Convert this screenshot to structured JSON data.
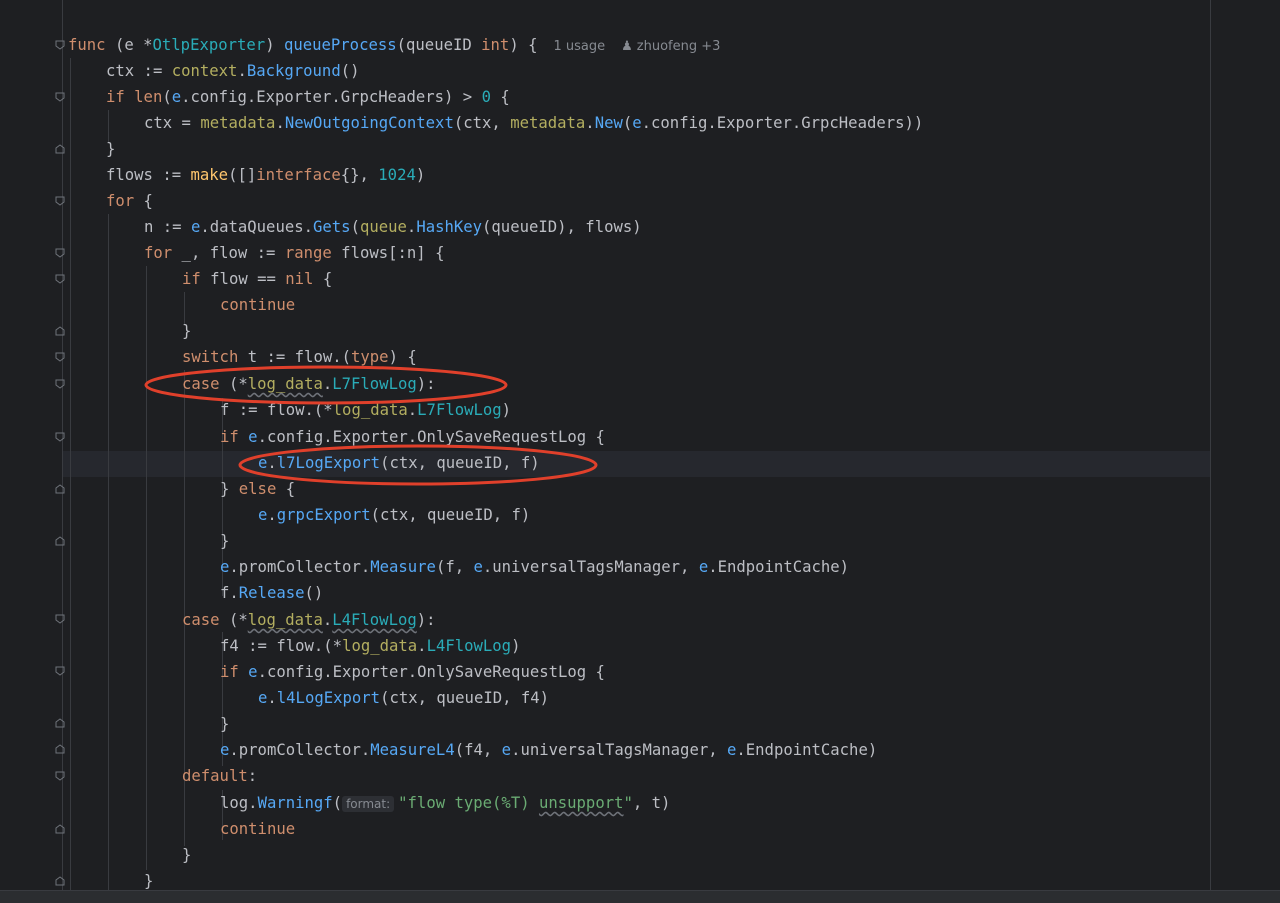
{
  "editor": {
    "hints": {
      "usages": "1 usage",
      "author": "zhuofeng +3",
      "format_param": "format:"
    },
    "code": {
      "l1_func": "func",
      "l1_recv_open": " (e *",
      "l1_type": "OtlpExporter",
      "l1_recv_close": ") ",
      "l1_name": "queueProcess",
      "l1_params_a": "(queueID ",
      "l1_int": "int",
      "l1_params_b": ") {",
      "l2_a": "ctx := ",
      "l2_pkg": "context",
      "l2_dot": ".",
      "l2_call": "Background",
      "l2_b": "()",
      "l3_if": "if ",
      "l3_len": "len",
      "l3_a": "(",
      "l3_e": "e",
      "l3_b": ".config.Exporter.GrpcHeaders) > ",
      "l3_zero": "0",
      "l3_c": " {",
      "l4_a": "ctx = ",
      "l4_pkg1": "metadata",
      "l4_dot1": ".",
      "l4_call1": "NewOutgoingContext",
      "l4_b": "(ctx, ",
      "l4_pkg2": "metadata",
      "l4_dot2": ".",
      "l4_call2": "New",
      "l4_c": "(",
      "l4_e": "e",
      "l4_d": ".config.Exporter.GrpcHeaders))",
      "l5": "}",
      "l6_a": "flows := ",
      "l6_make": "make",
      "l6_b": "([]",
      "l6_iface": "interface",
      "l6_c": "{}, ",
      "l6_num": "1024",
      "l6_d": ")",
      "l7_for": "for",
      "l7_a": " {",
      "l8_a": "n := ",
      "l8_e": "e",
      "l8_b": ".dataQueues.",
      "l8_call": "Gets",
      "l8_c": "(",
      "l8_pkg": "queue",
      "l8_dot": ".",
      "l8_call2": "HashKey",
      "l8_d": "(queueID), flows)",
      "l9_for": "for",
      "l9_a": " _, flow := ",
      "l9_range": "range",
      "l9_b": " flows[:n] {",
      "l10_if": "if",
      "l10_a": " flow == ",
      "l10_nil": "nil",
      "l10_b": " {",
      "l11_continue": "continue",
      "l12": "}",
      "l13_switch": "switch",
      "l13_a": " t := flow.(",
      "l13_type": "type",
      "l13_b": ") {",
      "l14_case": "case",
      "l14_a": " (*",
      "l14_pkg": "log_data",
      "l14_dot": ".",
      "l14_type": "L7FlowLog",
      "l14_b": "):",
      "l15_a": "f := flow.(*",
      "l15_pkg": "log_data",
      "l15_dot": ".",
      "l15_type": "L7FlowLog",
      "l15_b": ")",
      "l16_if": "if",
      "l16_a": " ",
      "l16_e": "e",
      "l16_b": ".config.Exporter.",
      "l16_field": "OnlySaveRequestLog",
      "l16_c": " {",
      "l17_e": "e",
      "l17_dot": ".",
      "l17_call": "l7LogExport",
      "l17_a": "(ctx, queueID, f)",
      "l18_a": "} ",
      "l18_else": "else",
      "l18_b": " {",
      "l19_e": "e",
      "l19_dot": ".",
      "l19_call": "grpcExport",
      "l19_a": "(ctx, queueID, f)",
      "l20": "}",
      "l21_e": "e",
      "l21_a": ".promCollector.",
      "l21_call": "Measure",
      "l21_b": "(f, ",
      "l21_e2": "e",
      "l21_c": ".universalTagsManager, ",
      "l21_e3": "e",
      "l21_d": ".EndpointCache)",
      "l22_a": "f.",
      "l22_call": "Release",
      "l22_b": "()",
      "l23_case": "case",
      "l23_a": " (*",
      "l23_pkg": "log_data",
      "l23_dot": ".",
      "l23_type": "L4FlowLog",
      "l23_b": "):",
      "l24_a": "f4 := flow.(*",
      "l24_pkg": "log_data",
      "l24_dot": ".",
      "l24_type": "L4FlowLog",
      "l24_b": ")",
      "l25_if": "if",
      "l25_a": " ",
      "l25_e": "e",
      "l25_b": ".config.Exporter.",
      "l25_field": "OnlySaveRequestLog",
      "l25_c": " {",
      "l26_e": "e",
      "l26_dot": ".",
      "l26_call": "l4LogExport",
      "l26_a": "(ctx, queueID, f4)",
      "l27": "}",
      "l28_e": "e",
      "l28_a": ".promCollector.",
      "l28_call": "MeasureL4",
      "l28_b": "(f4, ",
      "l28_e2": "e",
      "l28_c": ".universalTagsManager, ",
      "l28_e3": "e",
      "l28_d": ".EndpointCache)",
      "l29_default": "default",
      "l29_a": ":",
      "l30_a": "log.",
      "l30_call": "Warningf",
      "l30_b": "(",
      "l30_str1": "\"flow type(%T) ",
      "l30_str2": "unsupport",
      "l30_str3": "\"",
      "l30_c": ", t)",
      "l31_continue": "continue",
      "l32": "}",
      "l33": "}"
    }
  },
  "colors": {
    "background": "#1e1f22",
    "keyword": "#cf8e6d",
    "function": "#56a8f5",
    "type": "#2aacb8",
    "string": "#6aab73",
    "package": "#b3ae60",
    "text": "#bcbec4",
    "annotation": "#e0402b"
  }
}
